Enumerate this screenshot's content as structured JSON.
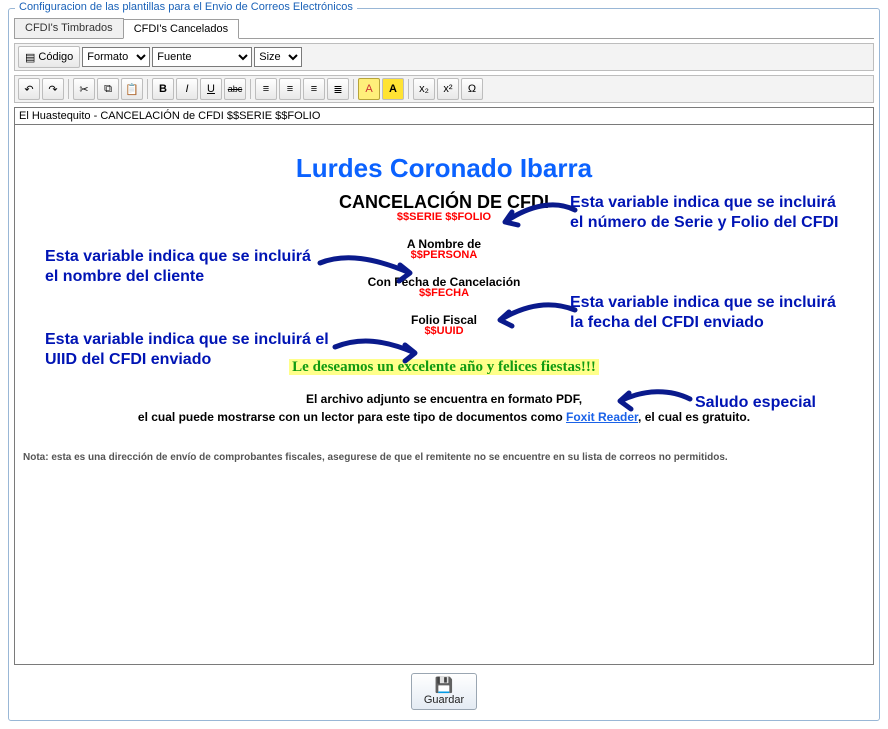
{
  "window": {
    "title": "Configuracion de las plantillas para el Envio de Correos Electrónicos"
  },
  "tabs": {
    "timbrados": "CFDI's Timbrados",
    "cancelados": "CFDI's Cancelados"
  },
  "toolbar": {
    "codigo_label": "Código",
    "formato": "Formato",
    "fuente": "Fuente",
    "size": "Size"
  },
  "subject": "El Huastequito - CANCELACIÓN de CFDI $$SERIE $$FOLIO",
  "body": {
    "name": "Lurdes Coronado Ibarra",
    "cancel_title": "CANCELACIÓN DE CFDI",
    "serie_folio_var": "$$SERIE $$FOLIO",
    "a_nombre_label": "A Nombre de",
    "persona_var": "$$PERSONA",
    "fecha_label": "Con Fecha de Cancelación",
    "fecha_var": "$$FECHA",
    "folio_fiscal_label": "Folio Fiscal",
    "uuid_var": "$$UUID",
    "wish": "Le deseamos un excelente año y felices fiestas!!!",
    "pdf_line1": "El archivo adjunto se encuentra en formato PDF,",
    "pdf_line2a": "el cual puede mostrarse con un lector para este tipo de documentos como ",
    "pdf_link": "Foxit Reader",
    "pdf_line2b": ", el cual es gratuito.",
    "note": "Nota: esta es una dirección de envío de comprobantes fiscales, asegurese de que el remitente no se encuentre en su lista de correos no permitidos."
  },
  "annotations": {
    "serie_folio": "Esta variable indica que se incluirá el número de Serie y Folio del CFDI",
    "nombre": "Esta variable indica que se incluirá el nombre del cliente",
    "fecha": "Esta variable indica que se incluirá la fecha del CFDI enviado",
    "uuid": "Esta variable indica que se incluirá el UIID del CFDI enviado",
    "saludo": "Saludo especial"
  },
  "buttons": {
    "save": "Guardar"
  },
  "icon_labels": {
    "undo": "↶",
    "redo": "↷",
    "bold": "B",
    "italic": "I",
    "underline": "U",
    "strike": "abc",
    "sub": "x₂",
    "sup": "x²",
    "omega": "Ω",
    "text_color": "A",
    "bg_color": "A"
  }
}
